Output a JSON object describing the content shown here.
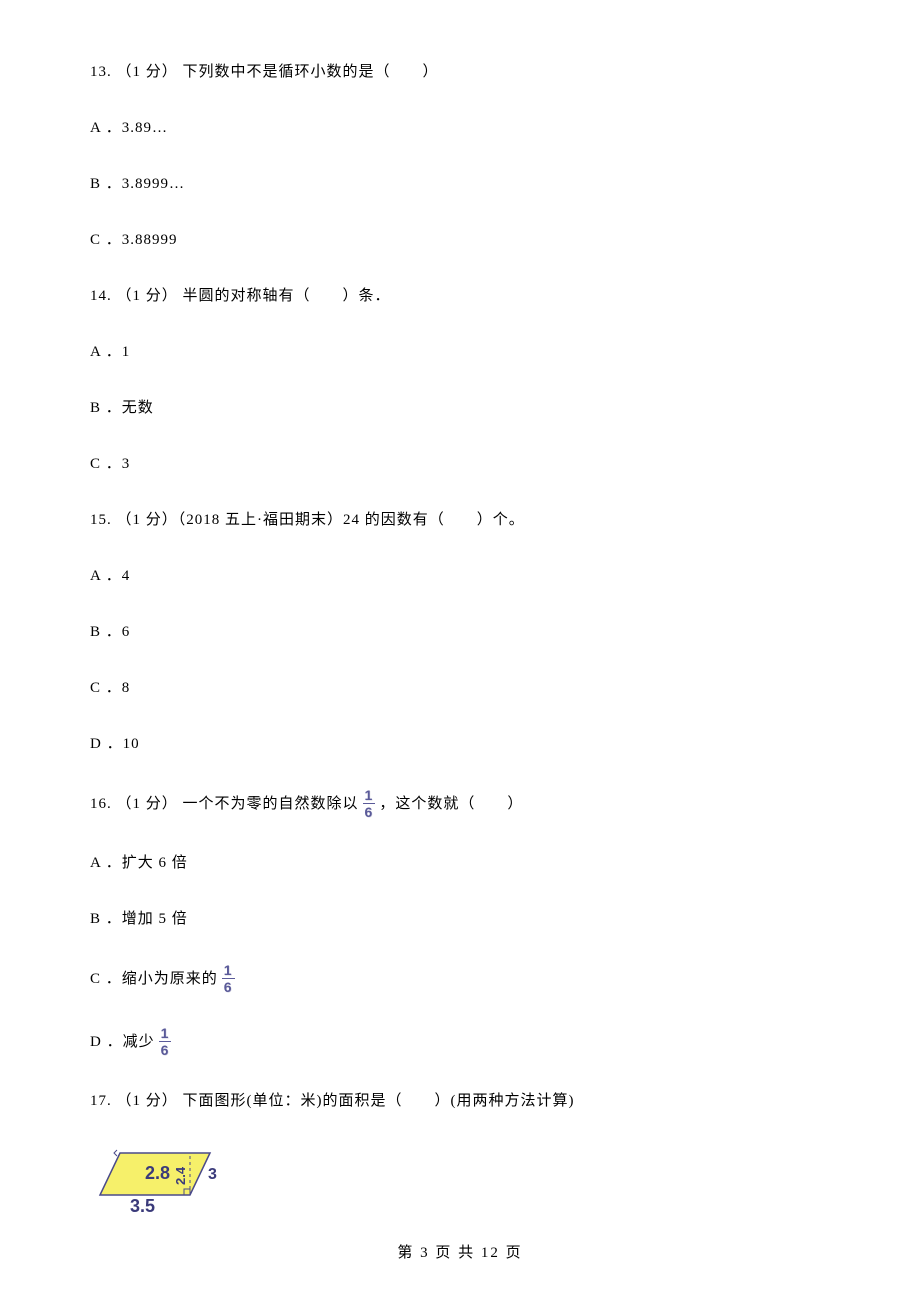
{
  "q13": {
    "stem": "13. （1 分） 下列数中不是循环小数的是（　　）",
    "options": {
      "a": "A ．3.89…",
      "b": "B ．3.8999…",
      "c": "C ．3.88999"
    }
  },
  "q14": {
    "stem": "14. （1 分） 半圆的对称轴有（　　）条．",
    "options": {
      "a": "A ．1",
      "b": "B ．无数",
      "c": "C ．3"
    }
  },
  "q15": {
    "stem": "15. （1 分）（2018 五上·福田期末）24 的因数有（　　）个。",
    "options": {
      "a": "A ．4",
      "b": "B ．6",
      "c": "C ．8",
      "d": "D ．10"
    }
  },
  "q16": {
    "stem_pre": "16. （1 分） 一个不为零的自然数除以 ",
    "stem_post": " ，这个数就（　　）",
    "frac_num": "1",
    "frac_den": "6",
    "options": {
      "a": "A ．扩大 6 倍",
      "b": "B ．增加 5 倍",
      "c_pre": "C ．缩小为原来的 ",
      "c_num": "1",
      "c_den": "6",
      "d_pre": "D ．减少 ",
      "d_num": "1",
      "d_den": "6"
    }
  },
  "q17": {
    "stem": "17. （1 分） 下面图形(单位：米)的面积是（　　）(用两种方法计算)",
    "figure": {
      "top_side": "2.8",
      "height": "2.4",
      "right_side": "3",
      "bottom": "3.5"
    }
  },
  "footer": "第 3 页 共 12 页"
}
